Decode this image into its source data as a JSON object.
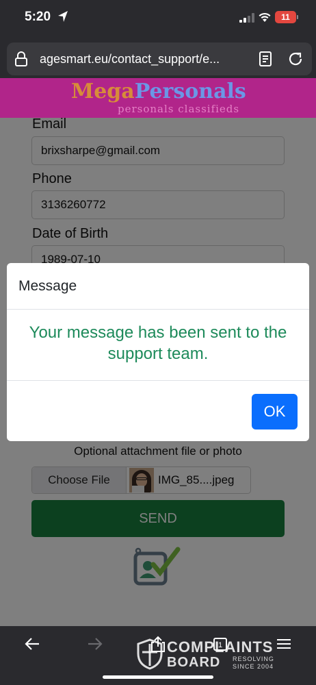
{
  "status_bar": {
    "time": "5:20",
    "battery": "11",
    "icons": [
      "location-arrow-icon",
      "signal-icon",
      "wifi-icon",
      "battery-icon"
    ]
  },
  "browser": {
    "url": "agesmart.eu/contact_support/e...",
    "icons": [
      "lock-icon",
      "reader-icon",
      "reload-icon"
    ]
  },
  "site": {
    "logo_part1": "Mega",
    "logo_part2": "Personals",
    "tagline": "personals classifieds",
    "colors": {
      "header_bg": "#b1258a",
      "mega": "#d78c3a",
      "personals": "#6b97e6"
    }
  },
  "form": {
    "email_label": "Email",
    "email_value": "brixsharpe@gmail.com",
    "phone_label": "Phone",
    "phone_value": "3136260772",
    "dob_label": "Date of Birth",
    "dob_value": "1989-07-10",
    "attachment_label": "Optional attachment file or photo",
    "choose_file_label": "Choose File",
    "file_name": "IMG_85....jpeg",
    "send_label": "SEND",
    "send_color": "#18803f"
  },
  "modal": {
    "title": "Message",
    "message": "Your message has been sent to the support team.",
    "ok_label": "OK",
    "message_color": "#1d8a5a",
    "ok_color": "#0a6efd"
  },
  "toolbar": {
    "icons": [
      "back-arrow-icon",
      "forward-arrow-icon",
      "share-icon",
      "tabs-icon",
      "menu-icon"
    ]
  },
  "watermark": {
    "line1": "COMPLAINTS",
    "line2": "BOARD",
    "line3a": "RESOLVING",
    "line3b": "SINCE 2004"
  }
}
